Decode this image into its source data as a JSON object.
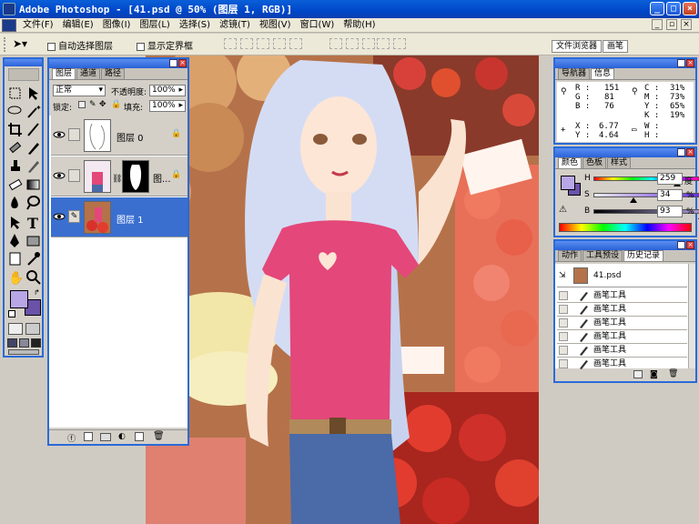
{
  "app": {
    "title": "Adobe Photoshop - [41.psd @ 50% (图层 1, RGB)]"
  },
  "menu": [
    "文件(F)",
    "编辑(E)",
    "图像(I)",
    "图层(L)",
    "选择(S)",
    "滤镜(T)",
    "视图(V)",
    "窗口(W)",
    "帮助(H)"
  ],
  "options": {
    "auto_select": "自动选择图层",
    "show_bounds": "显示定界框"
  },
  "palette_well": {
    "tab1": "文件浏览器",
    "tab2": "画笔"
  },
  "layers_panel": {
    "tabs": [
      "图层",
      "通道",
      "路径"
    ],
    "blend_mode": "正常",
    "opacity_label": "不透明度:",
    "opacity_value": "100%",
    "lock_label": "锁定:",
    "fill_label": "填充:",
    "fill_value": "100%",
    "layers": [
      {
        "name": "图层 0"
      },
      {
        "name": "图..."
      },
      {
        "name": "图层 1"
      }
    ]
  },
  "navigator_panel": {
    "tabs": [
      "导航器",
      "信息"
    ],
    "rgb": {
      "r_label": "R :",
      "r": "151",
      "g_label": "G :",
      "g": "81",
      "b_label": "B :",
      "b": "76"
    },
    "cmyk": {
      "c_label": "C :",
      "c": "31%",
      "m_label": "M :",
      "m": "73%",
      "y_label": "Y :",
      "y": "65%",
      "k_label": "K :",
      "k": "19%"
    },
    "xy": {
      "x_label": "X :",
      "x": "6.77",
      "y_label": "Y :",
      "y": "4.64"
    },
    "wh": {
      "w_label": "W :",
      "h_label": "H :"
    }
  },
  "color_panel": {
    "tabs": [
      "颜色",
      "色板",
      "样式"
    ],
    "h_label": "H",
    "h_value": "259",
    "h_unit": "度",
    "s_label": "S",
    "s_value": "34",
    "s_unit": "%",
    "b_label": "B",
    "b_value": "93",
    "b_unit": "%",
    "h_level": 0.72,
    "s_level": 0.34,
    "b_level": 0.93
  },
  "history_panel": {
    "tabs": [
      "动作",
      "工具预设",
      "历史记录"
    ],
    "snapshot": "41.psd",
    "items": [
      "画笔工具",
      "画笔工具",
      "画笔工具",
      "画笔工具",
      "画笔工具",
      "画笔工具"
    ]
  },
  "colors": {
    "title_blue": "#0047c9",
    "panel_border": "#2a6ad8",
    "selected_layer": "#3a6fd0",
    "foreground": "#b8a6e6",
    "background": "#6a52a8"
  }
}
